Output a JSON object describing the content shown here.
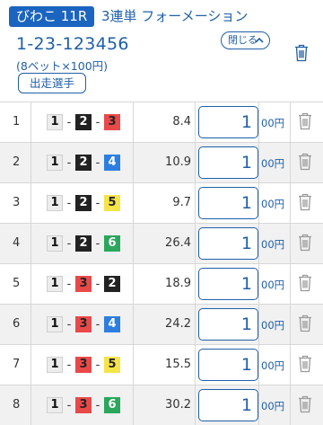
{
  "header": {
    "race": "びわこ 11R",
    "bet_type": "3連単 フォーメーション",
    "combo_code": "1-23-123456",
    "summary": "(8ベット×100円)",
    "close_label": "閉じる",
    "entry_button": "出走選手"
  },
  "rows": [
    {
      "no": "1",
      "first": "1",
      "sep1": "-",
      "second": "2",
      "sep2": "-",
      "third": "3",
      "odds": "8.4",
      "amount": "1",
      "unit": "00円"
    },
    {
      "no": "2",
      "first": "1",
      "sep1": "-",
      "second": "2",
      "sep2": "-",
      "third": "4",
      "odds": "10.9",
      "amount": "1",
      "unit": "00円"
    },
    {
      "no": "3",
      "first": "1",
      "sep1": "-",
      "second": "2",
      "sep2": "-",
      "third": "5",
      "odds": "9.7",
      "amount": "1",
      "unit": "00円"
    },
    {
      "no": "4",
      "first": "1",
      "sep1": "-",
      "second": "2",
      "sep2": "-",
      "third": "6",
      "odds": "26.4",
      "amount": "1",
      "unit": "00円"
    },
    {
      "no": "5",
      "first": "1",
      "sep1": "-",
      "second": "3",
      "sep2": "-",
      "third": "2",
      "odds": "18.9",
      "amount": "1",
      "unit": "00円"
    },
    {
      "no": "6",
      "first": "1",
      "sep1": "-",
      "second": "3",
      "sep2": "-",
      "third": "4",
      "odds": "24.2",
      "amount": "1",
      "unit": "00円"
    },
    {
      "no": "7",
      "first": "1",
      "sep1": "-",
      "second": "3",
      "sep2": "-",
      "third": "5",
      "odds": "15.5",
      "amount": "1",
      "unit": "00円"
    },
    {
      "no": "8",
      "first": "1",
      "sep1": "-",
      "second": "3",
      "sep2": "-",
      "third": "6",
      "odds": "30.2",
      "amount": "1",
      "unit": "00円"
    }
  ],
  "colors": {
    "accent": "#1f5fa8",
    "badge_bg": "#1b64c0",
    "boat_1": "#ececec",
    "boat_2": "#222222",
    "boat_3": "#e84a4a",
    "boat_4": "#2d7ee0",
    "boat_5": "#f5e34a",
    "boat_6": "#2aa75c"
  },
  "icons": {
    "close": "chevron-up-icon",
    "delete": "trash-icon"
  }
}
